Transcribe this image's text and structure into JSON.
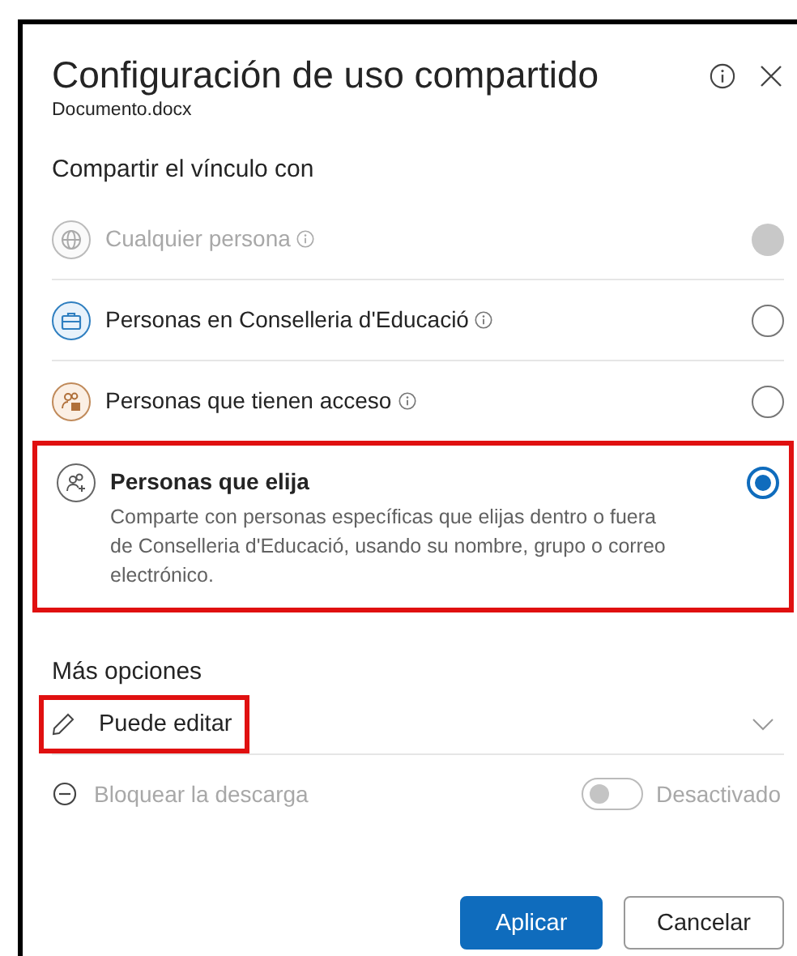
{
  "dialog": {
    "title": "Configuración de uso compartido",
    "subtitle": "Documento.docx"
  },
  "share_section": {
    "heading": "Compartir el vínculo con"
  },
  "options": [
    {
      "kind": "globe",
      "label": "Cualquier persona",
      "disabled": true,
      "selected": false,
      "highlighted": false
    },
    {
      "kind": "organization",
      "label": "Personas en Conselleria d'Educació",
      "disabled": false,
      "selected": false,
      "highlighted": false
    },
    {
      "kind": "access",
      "label": "Personas que tienen acceso",
      "disabled": false,
      "selected": false,
      "highlighted": false
    },
    {
      "kind": "specific",
      "label": "Personas que elija",
      "description": "Comparte con personas específicas que elijas dentro o fuera de Conselleria d'Educació, usando su nombre, grupo o correo electrónico.",
      "disabled": false,
      "selected": true,
      "highlighted": true
    }
  ],
  "more_options": {
    "heading": "Más opciones",
    "permission": {
      "label": "Puede editar",
      "highlighted": true
    },
    "block_download": {
      "label": "Bloquear la descarga",
      "on": false,
      "state_label": "Desactivado"
    }
  },
  "buttons": [
    {
      "kind": "primary",
      "label": "Aplicar"
    },
    {
      "kind": "secondary",
      "label": "Cancelar"
    }
  ]
}
